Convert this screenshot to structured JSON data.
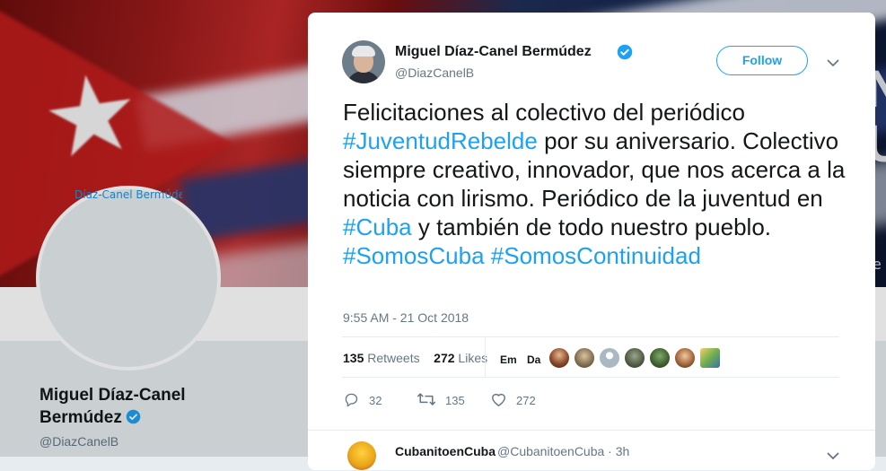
{
  "background": {
    "avatar_alt": "Díaz-Canel Bermúdez",
    "profile_name": "Miguel Díaz-Canel Bermúdez",
    "profile_handle": "@DiazCanelB",
    "edge_letters": [
      "N",
      "U"
    ],
    "edge_small": "e"
  },
  "tweet": {
    "author_name": "Miguel Díaz-Canel Bermúdez",
    "author_handle": "@DiazCanelB",
    "follow_label": "Follow",
    "text_parts": {
      "p1": "Felicitaciones al colectivo del periódico ",
      "h1": "#JuventudRebelde",
      "p2": " por su aniversario. Colectivo siempre creativo, innovador, que nos acerca a la noticia con lirismo. Periódico de la juventud en ",
      "h2": "#Cuba",
      "p3": " y también de todo nuestro pueblo. ",
      "h3": "#SomosCuba",
      "p4": " ",
      "h4": "#SomosContinuidad"
    },
    "timestamp": "9:55 AM - 21 Oct 2018",
    "retweets_count": "135",
    "retweets_label": "Retweets",
    "likes_count": "272",
    "likes_label": "Likes",
    "liker_initials": [
      "Em",
      "Da"
    ],
    "actions": {
      "reply_count": "32",
      "retweet_count": "135",
      "like_count": "272"
    }
  },
  "reply": {
    "name": "CubanitoenCuba",
    "handle_time": "@CubanitoenCuba · 3h"
  },
  "colors": {
    "accent": "#1da1f2",
    "text": "#14171a",
    "muted": "#657786"
  }
}
